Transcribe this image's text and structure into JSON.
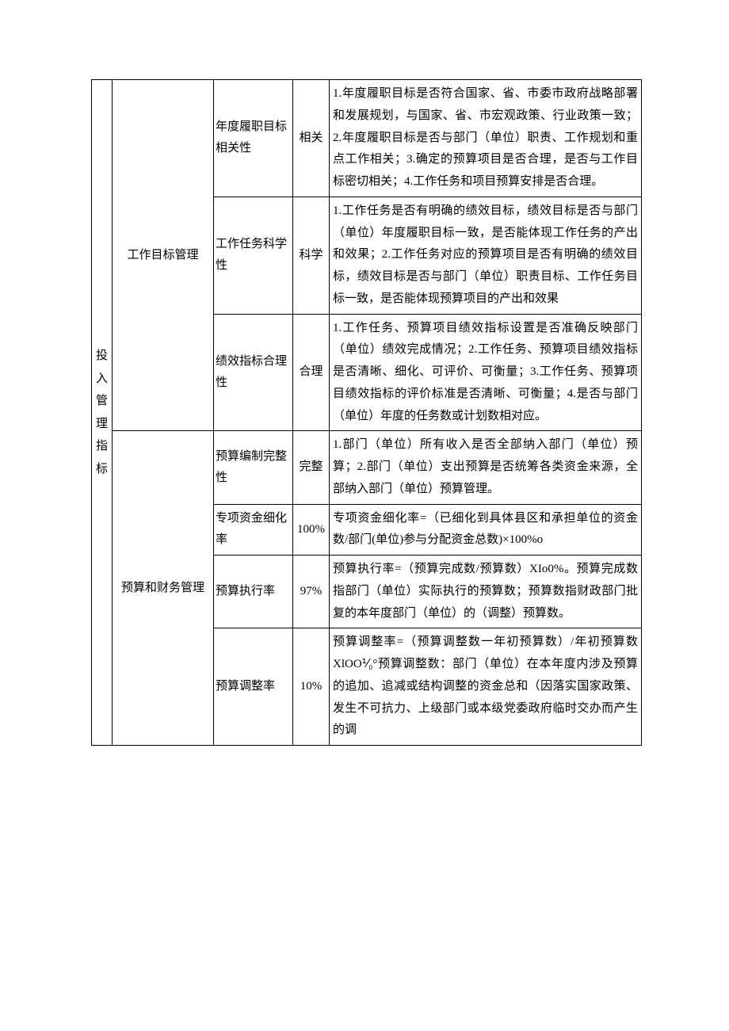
{
  "chart_data": {
    "type": "table",
    "group_col1": "投入管理指标",
    "sections": [
      {
        "col2": "工作目标管理",
        "rows": [
          {
            "col3": "年度履职目标相关性",
            "col4": "相关",
            "col5": "1.年度履职目标是否符合国家、省、市委市政府战略部署和发展规划，与国家、省、市宏观政策、行业政策一致；2.年度履职目标是否与部门（单位）职责、工作规划和重点工作相关；3.确定的预算项目是否合理，是否与工作目标密切相关；4.工作任务和项目预算安排是否合理。"
          },
          {
            "col3": "工作任务科学性",
            "col4": "科学",
            "col5": "1.工作任务是否有明确的绩效目标，绩效目标是否与部门（单位）年度履职目标一致，是否能体现工作任务的产出和效果；2.工作任务对应的预算项目是否有明确的绩效目标，绩效目标是否与部门（单位）职责目标、工作任务目标一致，是否能体现预算项目的产出和效果"
          },
          {
            "col3": "绩效指标合理性",
            "col4": "合理",
            "col5": "1.工作任务、预算项目绩效指标设置是否准确反映部门（单位）绩效完成情况；2.工作任务、预算项目绩效指标是否清晰、细化、可评价、可衡量；3.工作任务、预算项目绩效指标的评价标准是否清晰、可衡量；4.是否与部门（单位）年度的任务数或计划数相对应。"
          }
        ]
      },
      {
        "col2": "预算和财务管理",
        "rows": [
          {
            "col3": "预算编制完整性",
            "col4": "完整",
            "col5": "1.部门（单位）所有收入是否全部纳入部门（单位）预算；2.部门（单位）支出预算是否统筹各类资金来源，全部纳入部门（单位）预算管理。"
          },
          {
            "col3": "专项资金细化率",
            "col4": "100%",
            "col5": "专项资金细化率=（已细化到具体县区和承担单位的资金数/部门(单位)参与分配资金总数)×100%o"
          },
          {
            "col3": "预算执行率",
            "col4": "97%",
            "col5": "预算执行率=（预算完成数/预算数）XIo0%。预算完成数指部门（单位）实际执行的预算数；预算数指财政部门批复的本年度部门（单位）的（调整）预算数。"
          },
          {
            "col3": "预算调整率",
            "col4": "10%",
            "col5": "预算调整率=（预算调整数一年初预算数）/年初预算数 XlOO⅟₀°预算调整数：部门（单位）在本年度内涉及预算的追加、追减或结构调整的资金总和（因落实国家政策、发生不可抗力、上级部门或本级党委政府临时交办而产生的调"
          }
        ]
      }
    ]
  }
}
